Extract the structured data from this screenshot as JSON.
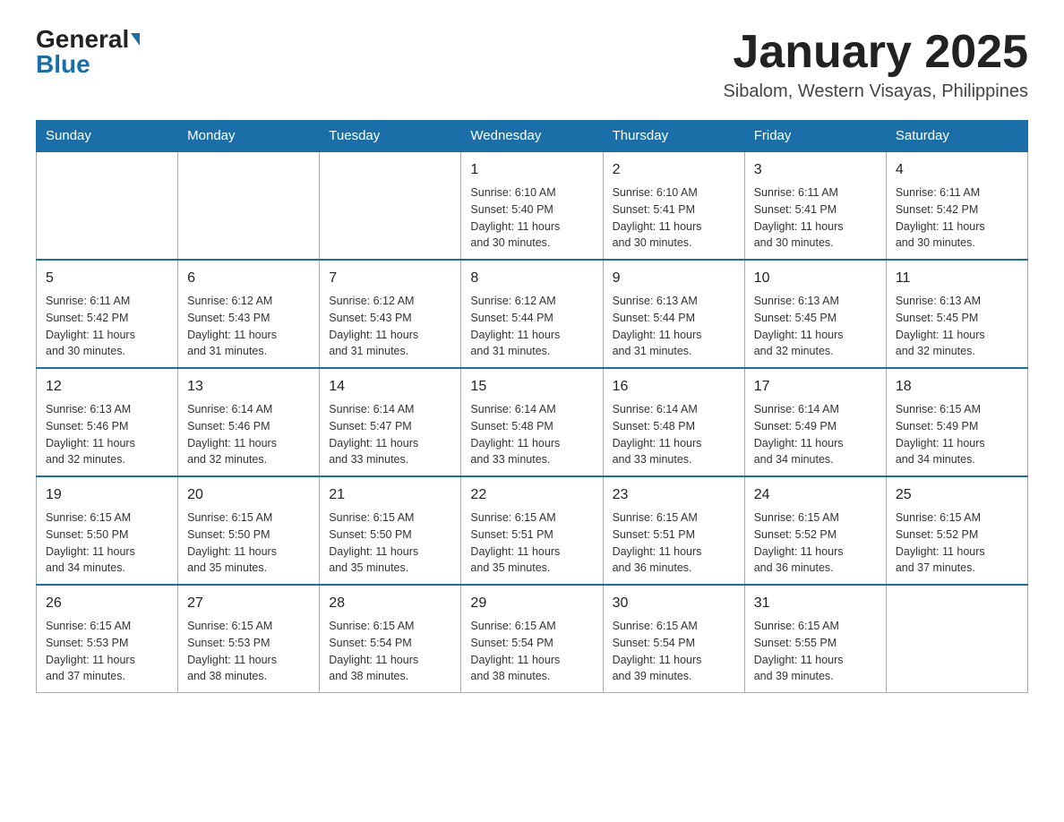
{
  "header": {
    "logo_general": "General",
    "logo_blue": "Blue",
    "month_title": "January 2025",
    "location": "Sibalom, Western Visayas, Philippines"
  },
  "days_of_week": [
    "Sunday",
    "Monday",
    "Tuesday",
    "Wednesday",
    "Thursday",
    "Friday",
    "Saturday"
  ],
  "weeks": [
    [
      {
        "day": "",
        "info": ""
      },
      {
        "day": "",
        "info": ""
      },
      {
        "day": "",
        "info": ""
      },
      {
        "day": "1",
        "info": "Sunrise: 6:10 AM\nSunset: 5:40 PM\nDaylight: 11 hours\nand 30 minutes."
      },
      {
        "day": "2",
        "info": "Sunrise: 6:10 AM\nSunset: 5:41 PM\nDaylight: 11 hours\nand 30 minutes."
      },
      {
        "day": "3",
        "info": "Sunrise: 6:11 AM\nSunset: 5:41 PM\nDaylight: 11 hours\nand 30 minutes."
      },
      {
        "day": "4",
        "info": "Sunrise: 6:11 AM\nSunset: 5:42 PM\nDaylight: 11 hours\nand 30 minutes."
      }
    ],
    [
      {
        "day": "5",
        "info": "Sunrise: 6:11 AM\nSunset: 5:42 PM\nDaylight: 11 hours\nand 30 minutes."
      },
      {
        "day": "6",
        "info": "Sunrise: 6:12 AM\nSunset: 5:43 PM\nDaylight: 11 hours\nand 31 minutes."
      },
      {
        "day": "7",
        "info": "Sunrise: 6:12 AM\nSunset: 5:43 PM\nDaylight: 11 hours\nand 31 minutes."
      },
      {
        "day": "8",
        "info": "Sunrise: 6:12 AM\nSunset: 5:44 PM\nDaylight: 11 hours\nand 31 minutes."
      },
      {
        "day": "9",
        "info": "Sunrise: 6:13 AM\nSunset: 5:44 PM\nDaylight: 11 hours\nand 31 minutes."
      },
      {
        "day": "10",
        "info": "Sunrise: 6:13 AM\nSunset: 5:45 PM\nDaylight: 11 hours\nand 32 minutes."
      },
      {
        "day": "11",
        "info": "Sunrise: 6:13 AM\nSunset: 5:45 PM\nDaylight: 11 hours\nand 32 minutes."
      }
    ],
    [
      {
        "day": "12",
        "info": "Sunrise: 6:13 AM\nSunset: 5:46 PM\nDaylight: 11 hours\nand 32 minutes."
      },
      {
        "day": "13",
        "info": "Sunrise: 6:14 AM\nSunset: 5:46 PM\nDaylight: 11 hours\nand 32 minutes."
      },
      {
        "day": "14",
        "info": "Sunrise: 6:14 AM\nSunset: 5:47 PM\nDaylight: 11 hours\nand 33 minutes."
      },
      {
        "day": "15",
        "info": "Sunrise: 6:14 AM\nSunset: 5:48 PM\nDaylight: 11 hours\nand 33 minutes."
      },
      {
        "day": "16",
        "info": "Sunrise: 6:14 AM\nSunset: 5:48 PM\nDaylight: 11 hours\nand 33 minutes."
      },
      {
        "day": "17",
        "info": "Sunrise: 6:14 AM\nSunset: 5:49 PM\nDaylight: 11 hours\nand 34 minutes."
      },
      {
        "day": "18",
        "info": "Sunrise: 6:15 AM\nSunset: 5:49 PM\nDaylight: 11 hours\nand 34 minutes."
      }
    ],
    [
      {
        "day": "19",
        "info": "Sunrise: 6:15 AM\nSunset: 5:50 PM\nDaylight: 11 hours\nand 34 minutes."
      },
      {
        "day": "20",
        "info": "Sunrise: 6:15 AM\nSunset: 5:50 PM\nDaylight: 11 hours\nand 35 minutes."
      },
      {
        "day": "21",
        "info": "Sunrise: 6:15 AM\nSunset: 5:50 PM\nDaylight: 11 hours\nand 35 minutes."
      },
      {
        "day": "22",
        "info": "Sunrise: 6:15 AM\nSunset: 5:51 PM\nDaylight: 11 hours\nand 35 minutes."
      },
      {
        "day": "23",
        "info": "Sunrise: 6:15 AM\nSunset: 5:51 PM\nDaylight: 11 hours\nand 36 minutes."
      },
      {
        "day": "24",
        "info": "Sunrise: 6:15 AM\nSunset: 5:52 PM\nDaylight: 11 hours\nand 36 minutes."
      },
      {
        "day": "25",
        "info": "Sunrise: 6:15 AM\nSunset: 5:52 PM\nDaylight: 11 hours\nand 37 minutes."
      }
    ],
    [
      {
        "day": "26",
        "info": "Sunrise: 6:15 AM\nSunset: 5:53 PM\nDaylight: 11 hours\nand 37 minutes."
      },
      {
        "day": "27",
        "info": "Sunrise: 6:15 AM\nSunset: 5:53 PM\nDaylight: 11 hours\nand 38 minutes."
      },
      {
        "day": "28",
        "info": "Sunrise: 6:15 AM\nSunset: 5:54 PM\nDaylight: 11 hours\nand 38 minutes."
      },
      {
        "day": "29",
        "info": "Sunrise: 6:15 AM\nSunset: 5:54 PM\nDaylight: 11 hours\nand 38 minutes."
      },
      {
        "day": "30",
        "info": "Sunrise: 6:15 AM\nSunset: 5:54 PM\nDaylight: 11 hours\nand 39 minutes."
      },
      {
        "day": "31",
        "info": "Sunrise: 6:15 AM\nSunset: 5:55 PM\nDaylight: 11 hours\nand 39 minutes."
      },
      {
        "day": "",
        "info": ""
      }
    ]
  ]
}
